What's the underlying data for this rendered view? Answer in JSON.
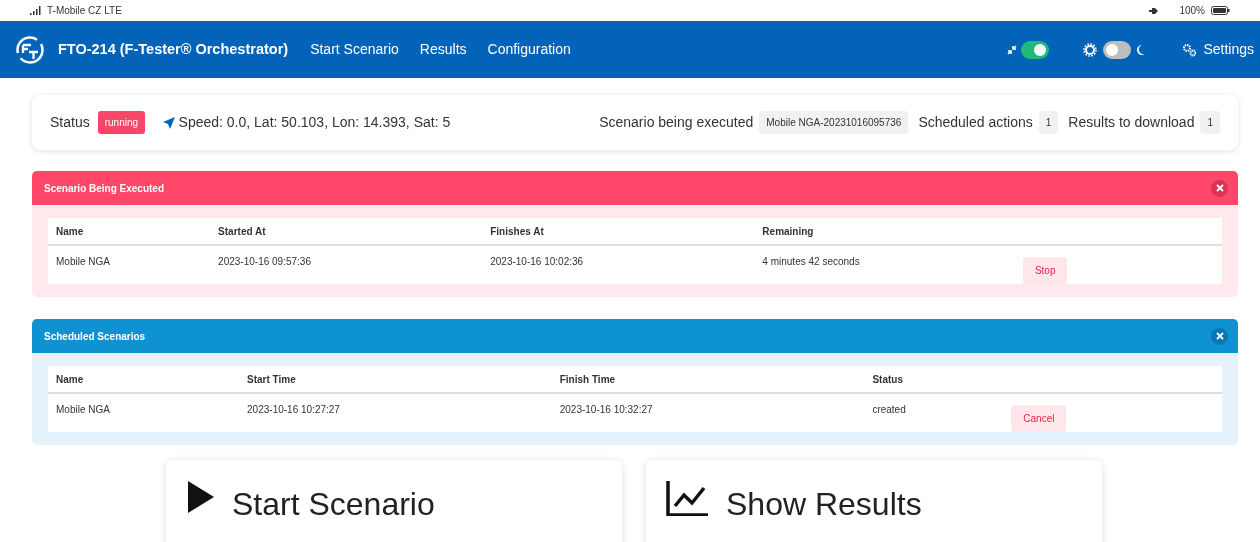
{
  "device_status": {
    "carrier": "T-Mobile CZ LTE",
    "battery": "100%"
  },
  "navbar": {
    "brand": "FTO-214 (F-Tester® Orchestrator)",
    "links": [
      {
        "label": "Start Scenario"
      },
      {
        "label": "Results"
      },
      {
        "label": "Configuration"
      }
    ],
    "compact_toggle": {
      "on": true
    },
    "dark_mode_toggle": {
      "on": false
    },
    "settings": "Settings"
  },
  "status_card": {
    "status_label": "Status",
    "status": "running",
    "gps": "Speed: 0.0, Lat: 50.103, Lon: 14.393, Sat: 5",
    "scenario_label": "Scenario being executed",
    "scenario": "Mobile NGA-20231016095736",
    "scheduled_label": "Scheduled actions",
    "scheduled": "1",
    "results_label": "Results to download",
    "results": "1"
  },
  "panels": [
    {
      "kind": "danger",
      "title": "Scenario Being Executed",
      "columns": [
        "Name",
        "Started At",
        "Finishes At",
        "Remaining"
      ],
      "rows": [
        {
          "cells": [
            "Mobile NGA",
            "2023-10-16 09:57:36",
            "2023-10-16 10:02:36",
            "4 minutes 42 seconds"
          ],
          "action": "Stop"
        }
      ]
    },
    {
      "kind": "info",
      "title": "Scheduled Scenarios",
      "columns": [
        "Name",
        "Start Time",
        "Finish Time",
        "Status"
      ],
      "rows": [
        {
          "cells": [
            "Mobile NGA",
            "2023-10-16 10:27:27",
            "2023-10-16 10:32:27",
            "created"
          ],
          "action": "Cancel"
        }
      ]
    }
  ],
  "big_buttons": [
    {
      "kind": "play",
      "label": "Start Scenario"
    },
    {
      "kind": "chart",
      "label": "Show Results"
    }
  ]
}
